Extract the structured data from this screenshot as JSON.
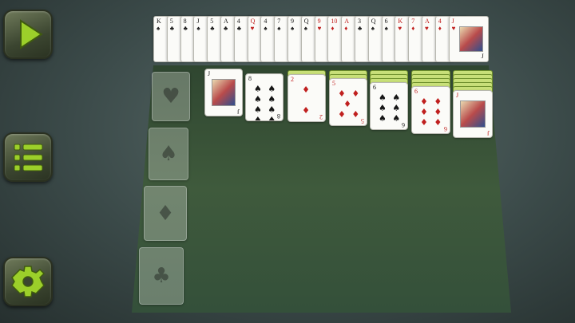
{
  "menu": {
    "play_icon": "play-icon",
    "list_icon": "menu-list-icon",
    "settings_icon": "gear-icon"
  },
  "colors": {
    "button_accent": "#9ccf2a",
    "felt": "#3f5a3c",
    "card_back": "#b5d35a"
  },
  "stock": {
    "cards": [
      {
        "rank": "K",
        "suit": "♠"
      },
      {
        "rank": "5",
        "suit": "♣"
      },
      {
        "rank": "8",
        "suit": "♣"
      },
      {
        "rank": "J",
        "suit": "♠"
      },
      {
        "rank": "5",
        "suit": "♣"
      },
      {
        "rank": "A",
        "suit": "♣"
      },
      {
        "rank": "4",
        "suit": "♣"
      },
      {
        "rank": "Q",
        "suit": "♥"
      },
      {
        "rank": "4",
        "suit": "♠"
      },
      {
        "rank": "7",
        "suit": "♠"
      },
      {
        "rank": "9",
        "suit": "♠"
      },
      {
        "rank": "Q",
        "suit": "♠"
      },
      {
        "rank": "9",
        "suit": "♥"
      },
      {
        "rank": "10",
        "suit": "♦"
      },
      {
        "rank": "A",
        "suit": "♦"
      },
      {
        "rank": "3",
        "suit": "♣"
      },
      {
        "rank": "Q",
        "suit": "♠"
      },
      {
        "rank": "6",
        "suit": "♠"
      },
      {
        "rank": "K",
        "suit": "♥"
      },
      {
        "rank": "7",
        "suit": "♦"
      },
      {
        "rank": "A",
        "suit": "♥"
      },
      {
        "rank": "4",
        "suit": "♦"
      },
      {
        "rank": "J",
        "suit": "♥"
      }
    ],
    "last_corner": "J"
  },
  "foundations": [
    {
      "suit": "♥"
    },
    {
      "suit": "♠"
    },
    {
      "suit": "♦"
    },
    {
      "suit": "♣"
    }
  ],
  "tableau": [
    {
      "hidden": 0,
      "top": {
        "rank": "J",
        "suit": "♣",
        "face": true
      }
    },
    {
      "hidden": 0,
      "top": {
        "rank": "8",
        "suit": "♠",
        "pips": "♠ ♠\n♠ ♠\n♠ ♠\n♠ ♠"
      }
    },
    {
      "hidden": 1,
      "top": {
        "rank": "2",
        "suit": "♦",
        "pips": "♦\n\n♦"
      }
    },
    {
      "hidden": 2,
      "top": {
        "rank": "5",
        "suit": "♦",
        "pips": "♦ ♦\n♦\n♦ ♦"
      }
    },
    {
      "hidden": 3,
      "top": {
        "rank": "6",
        "suit": "♠",
        "pips": "♠ ♠\n♠ ♠\n♠ ♠"
      }
    },
    {
      "hidden": 4,
      "top": {
        "rank": "6",
        "suit": "♦",
        "pips": "♦ ♦\n♦ ♦\n♦ ♦"
      }
    },
    {
      "hidden": 5,
      "top": {
        "rank": "J",
        "suit": "♥",
        "face": true
      }
    }
  ]
}
